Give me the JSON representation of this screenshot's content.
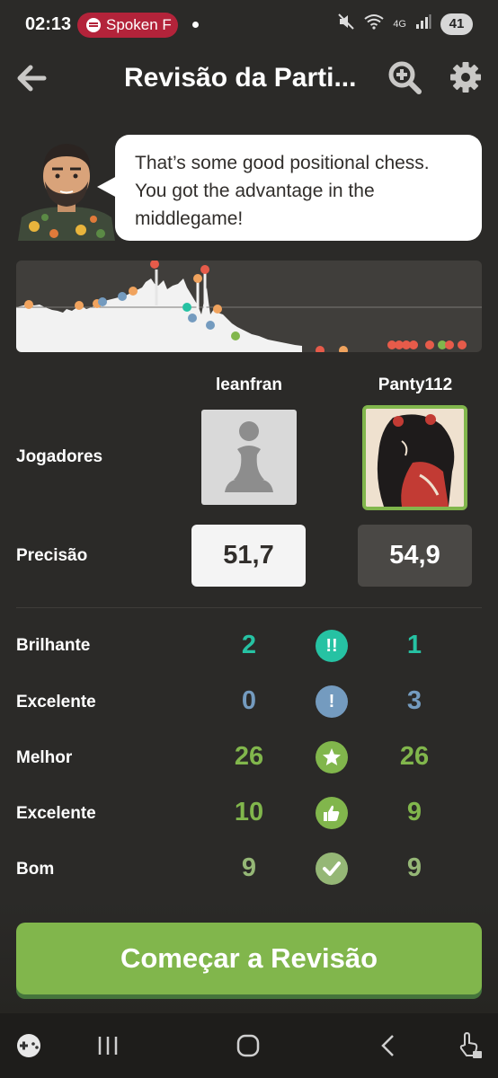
{
  "status_bar": {
    "time": "02:13",
    "spotify_text": "Spoken F",
    "network": "4G",
    "battery": "41"
  },
  "header": {
    "title": "Revisão da Parti..."
  },
  "coach": {
    "message": "That’s some good positional chess. You got the advantage in the middlegame!"
  },
  "players": {
    "label": "Jogadores",
    "white_name": "leanfran",
    "black_name": "Panty112"
  },
  "accuracy": {
    "label": "Precisão",
    "white": "51,7",
    "black": "54,9"
  },
  "classifications": [
    {
      "label": "Brilhante",
      "white": "2",
      "black": "1",
      "icon": "brilliant-icon",
      "color": "#26c2a3"
    },
    {
      "label": "Excelente",
      "white": "0",
      "black": "3",
      "icon": "great-move-icon",
      "color": "#749bbf"
    },
    {
      "label": "Melhor",
      "white": "26",
      "black": "26",
      "icon": "best-star-icon",
      "color": "#81b64c"
    },
    {
      "label": "Excelente",
      "white": "10",
      "black": "9",
      "icon": "excellent-thumb-icon",
      "color": "#81b64c"
    },
    {
      "label": "Bom",
      "white": "9",
      "black": "9",
      "icon": "good-check-icon",
      "color": "#95b776"
    }
  ],
  "cta": {
    "label": "Começar a Revisão"
  },
  "colors": {
    "background": "#2b2a28",
    "accent_green": "#81b64c",
    "brilliant": "#26c2a3",
    "great": "#749bbf"
  }
}
